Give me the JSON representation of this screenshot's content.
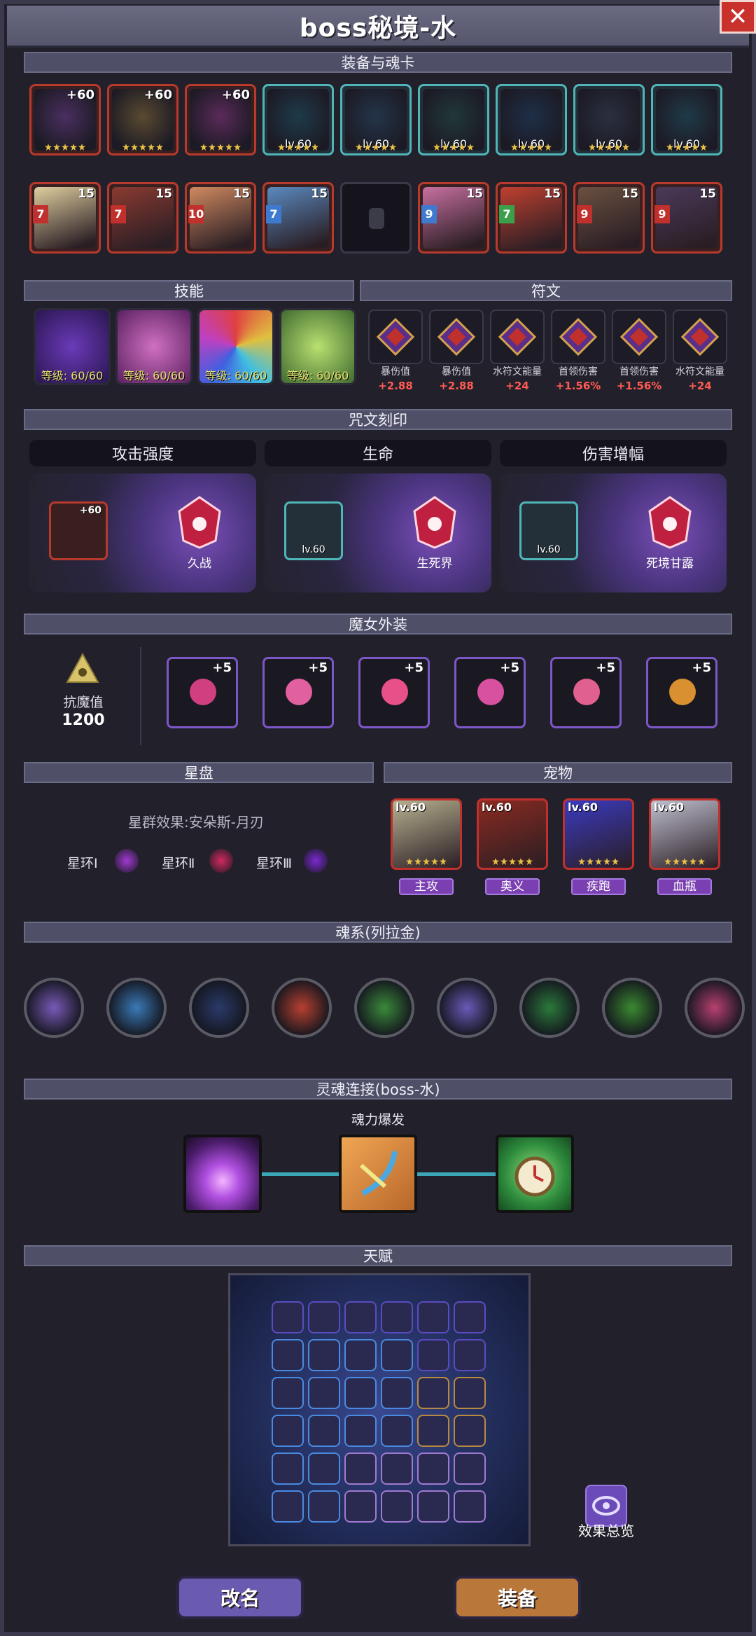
{
  "window": {
    "title": "boss秘境-水",
    "close_icon": "close-icon"
  },
  "sections": {
    "equipment": "装备与魂卡",
    "skills": "技能",
    "runes": "符文",
    "curse": "咒文刻印",
    "witch": "魔女外装",
    "starchart": "星盘",
    "pets": "宠物",
    "soul_system": "魂系(列拉金)",
    "soul_link": "灵魂连接(boss-水)",
    "talent": "天赋"
  },
  "equipment": {
    "row1": [
      {
        "label": "+60"
      },
      {
        "label": "+60"
      },
      {
        "label": "+60"
      },
      {
        "label": "lv.60"
      },
      {
        "label": "lv.60"
      },
      {
        "label": "lv.60"
      },
      {
        "label": "lv.60"
      },
      {
        "label": "lv.60"
      },
      {
        "label": "lv.60"
      }
    ],
    "row2": [
      {
        "top": "15",
        "star": "7"
      },
      {
        "top": "15",
        "star": "7"
      },
      {
        "top": "15",
        "star": "10"
      },
      {
        "top": "15",
        "star": "7"
      },
      {
        "top": "",
        "star": ""
      },
      {
        "top": "15",
        "star": "9"
      },
      {
        "top": "15",
        "star": "7"
      },
      {
        "top": "15",
        "star": "9"
      },
      {
        "top": "15",
        "star": "9"
      }
    ]
  },
  "skills": [
    {
      "level": "等级: 60/60"
    },
    {
      "level": "等级: 60/60"
    },
    {
      "level": "等级: 60/60"
    },
    {
      "level": "等级: 60/60"
    }
  ],
  "runes": [
    {
      "name": "暴伤值",
      "value": "+2.88"
    },
    {
      "name": "暴伤值",
      "value": "+2.88"
    },
    {
      "name": "水符文能量",
      "value": "+24"
    },
    {
      "name": "首领伤害",
      "value": "+1.56%"
    },
    {
      "name": "首领伤害",
      "value": "+1.56%"
    },
    {
      "name": "水符文能量",
      "value": "+24"
    }
  ],
  "curse": [
    {
      "header": "攻击强度",
      "card": "+60",
      "gem": "久战"
    },
    {
      "header": "生命",
      "card": "lv.60",
      "gem": "生死界"
    },
    {
      "header": "伤害增幅",
      "card": "lv.60",
      "gem": "死境甘露"
    }
  ],
  "witch": {
    "resist_label": "抗魔值",
    "resist_value": "1200",
    "items": [
      {
        "plus": "+5"
      },
      {
        "plus": "+5"
      },
      {
        "plus": "+5"
      },
      {
        "plus": "+5"
      },
      {
        "plus": "+5"
      },
      {
        "plus": "+5"
      }
    ]
  },
  "starchart": {
    "effect": "星群效果:安朵斯-月刃",
    "rings": [
      "星环Ⅰ",
      "星环Ⅱ",
      "星环Ⅲ"
    ]
  },
  "pets": [
    {
      "lv": "lv.60",
      "tag": "主攻"
    },
    {
      "lv": "lv.60",
      "tag": "奥义"
    },
    {
      "lv": "lv.60",
      "tag": "疾跑"
    },
    {
      "lv": "lv.60",
      "tag": "血瓶"
    }
  ],
  "soul_link": {
    "subtitle": "魂力爆发"
  },
  "talent": {
    "overview": "效果总览"
  },
  "buttons": {
    "rename": "改名",
    "equip": "装备"
  },
  "colors": {
    "accent_purple": "#7a52c4",
    "rune_red": "#ff5a52",
    "gold_button": "#b9773a"
  }
}
